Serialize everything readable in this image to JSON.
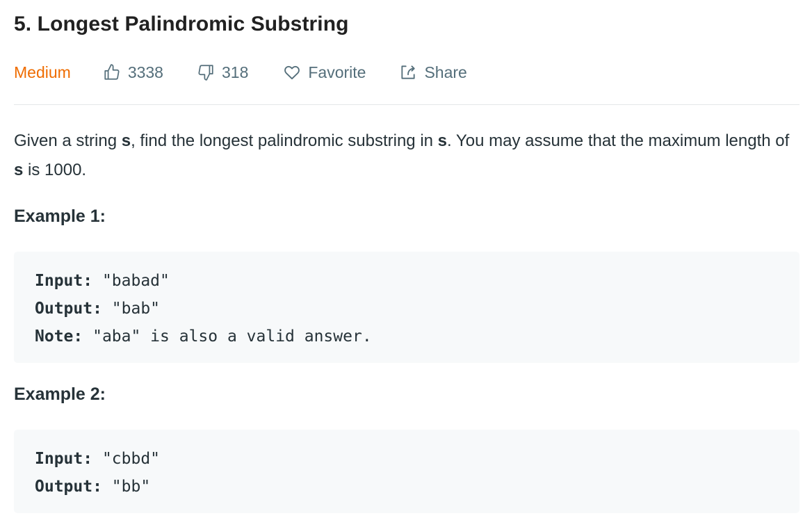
{
  "problem": {
    "title": "5. Longest Palindromic Substring",
    "difficulty": "Medium",
    "likes": "3338",
    "dislikes": "318",
    "favorite_label": "Favorite",
    "share_label": "Share"
  },
  "description": {
    "part1": "Given a string ",
    "var1": "s",
    "part2": ", find the longest palindromic substring in ",
    "var2": "s",
    "part3": ". You may assume that the maximum length of ",
    "var3": "s",
    "part4": " is 1000."
  },
  "examples": [
    {
      "heading": "Example 1:",
      "input_label": "Input:",
      "input_value": " \"babad\"",
      "output_label": "Output:",
      "output_value": " \"bab\"",
      "note_label": "Note:",
      "note_value": " \"aba\" is also a valid answer."
    },
    {
      "heading": "Example 2:",
      "input_label": "Input:",
      "input_value": " \"cbbd\"",
      "output_label": "Output:",
      "output_value": " \"bb\""
    }
  ],
  "colors": {
    "difficulty_medium": "#ef6c00",
    "meta_text": "#546e7a",
    "code_bg": "#f7f9fa",
    "divider": "#e4e7e9"
  },
  "icons": [
    "thumbs-up-icon",
    "thumbs-down-icon",
    "heart-icon",
    "share-icon"
  ]
}
